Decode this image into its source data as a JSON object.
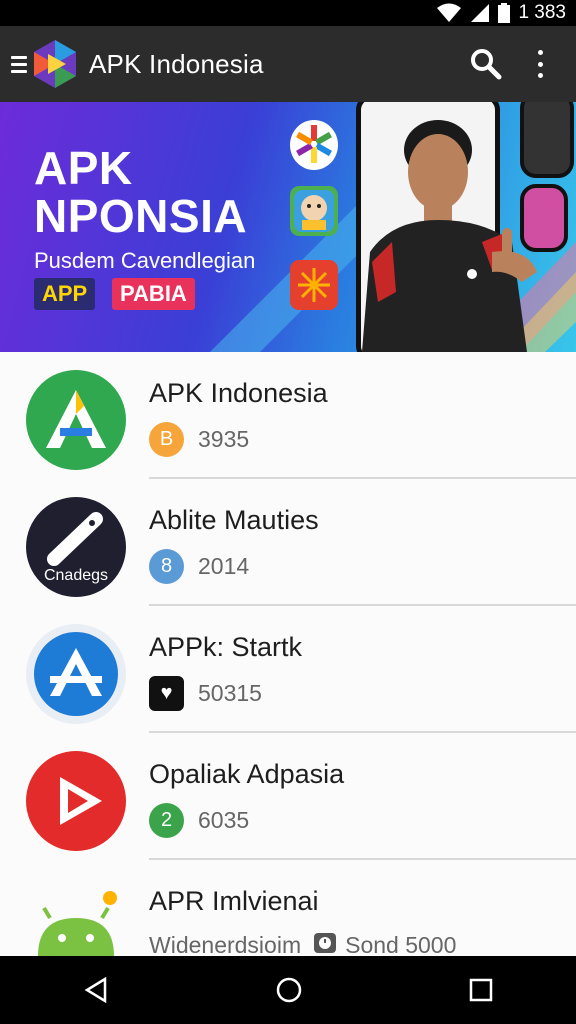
{
  "status_bar": {
    "time": "1 383",
    "icons": [
      "wifi-icon",
      "signal-icon",
      "battery-icon"
    ]
  },
  "app_bar": {
    "title": "APK Indonesia",
    "icons": [
      "menu-icon",
      "app-logo-icon",
      "search-icon",
      "more-vert-icon"
    ]
  },
  "banner": {
    "title_line1": "APK",
    "title_line2": "NPONSIA",
    "subtitle": "Pusdem Cavendlegian",
    "tag1": "APP",
    "tag2": "PABIA"
  },
  "apps": [
    {
      "name": "APK Indonesia",
      "badge": "B",
      "count": "3935",
      "badge_color": "#f6a53a"
    },
    {
      "name": "Ablite Mauties",
      "badge": "8",
      "count": "2014",
      "badge_color": "#5b9bd5",
      "icon_text": "Cnadegs"
    },
    {
      "name": "APPk: Startk",
      "badge": "♥",
      "count": "50315",
      "badge_color": "#111111"
    },
    {
      "name": "Opaliak Adpasia",
      "badge": "2",
      "count": "6035",
      "badge_color": "#3ba44a"
    },
    {
      "name": "APR Imlvienai",
      "meta_label": "Widenerdsioim",
      "meta_value": "Sond 5000",
      "badge_color": "#555555"
    }
  ],
  "nav_bar": {
    "icons": [
      "back-icon",
      "home-icon",
      "recents-icon"
    ]
  }
}
